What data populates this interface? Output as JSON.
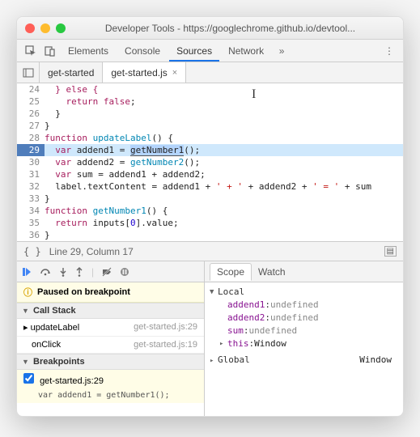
{
  "window": {
    "title": "Developer Tools - https://googlechrome.github.io/devtool..."
  },
  "mainTabs": {
    "elements": "Elements",
    "console": "Console",
    "sources": "Sources",
    "network": "Network"
  },
  "fileTabs": {
    "t0": "get-started",
    "t1": "get-started.js"
  },
  "code": {
    "l24": "  } else {",
    "l25_a": "    ",
    "l25_b": "return",
    "l25_c": " ",
    "l25_d": "false",
    "l25_e": ";",
    "l26": "  }",
    "l27": "}",
    "l28_a": "function",
    "l28_b": " ",
    "l28_c": "updateLabel",
    "l28_d": "() {",
    "l29_a": "  ",
    "l29_b": "var",
    "l29_c": " addend1 = ",
    "l29_d": "getNumber1",
    "l29_e": "();",
    "l30_a": "  ",
    "l30_b": "var",
    "l30_c": " addend2 = ",
    "l30_d": "getNumber2",
    "l30_e": "();",
    "l31_a": "  ",
    "l31_b": "var",
    "l31_c": " sum = addend1 + addend2;",
    "l32_a": "  label.textContent = addend1 + ",
    "l32_b": "' + '",
    "l32_c": " + addend2 + ",
    "l32_d": "' = '",
    "l32_e": " + sum",
    "l33": "}",
    "l34_a": "function",
    "l34_b": " ",
    "l34_c": "getNumber1",
    "l34_d": "() {",
    "l35_a": "  ",
    "l35_b": "return",
    "l35_c": " inputs[",
    "l35_d": "0",
    "l35_e": "].value;",
    "l36": "}",
    "g24": "24",
    "g25": "25",
    "g26": "26",
    "g27": "27",
    "g28": "28",
    "g29": "29",
    "g30": "30",
    "g31": "31",
    "g32": "32",
    "g33": "33",
    "g34": "34",
    "g35": "35",
    "g36": "36"
  },
  "status": {
    "pos": "Line 29, Column 17"
  },
  "pause": {
    "msg": "Paused on breakpoint"
  },
  "sections": {
    "callstack": "Call Stack",
    "breakpoints": "Breakpoints"
  },
  "stack": {
    "f0_name": "updateLabel",
    "f0_loc": "get-started.js:29",
    "f1_name": "onClick",
    "f1_loc": "get-started.js:19"
  },
  "breakpoints": {
    "b0_label": "get-started.js:29",
    "b0_code": "var addend1 = getNumber1();"
  },
  "scope": {
    "tab_scope": "Scope",
    "tab_watch": "Watch",
    "local": "Local",
    "p0_k": "addend1",
    "p0_v": "undefined",
    "p1_k": "addend2",
    "p1_v": "undefined",
    "p2_k": "sum",
    "p2_v": "undefined",
    "p3_k": "this",
    "p3_v": "Window",
    "global": "Global",
    "global_v": "Window"
  }
}
